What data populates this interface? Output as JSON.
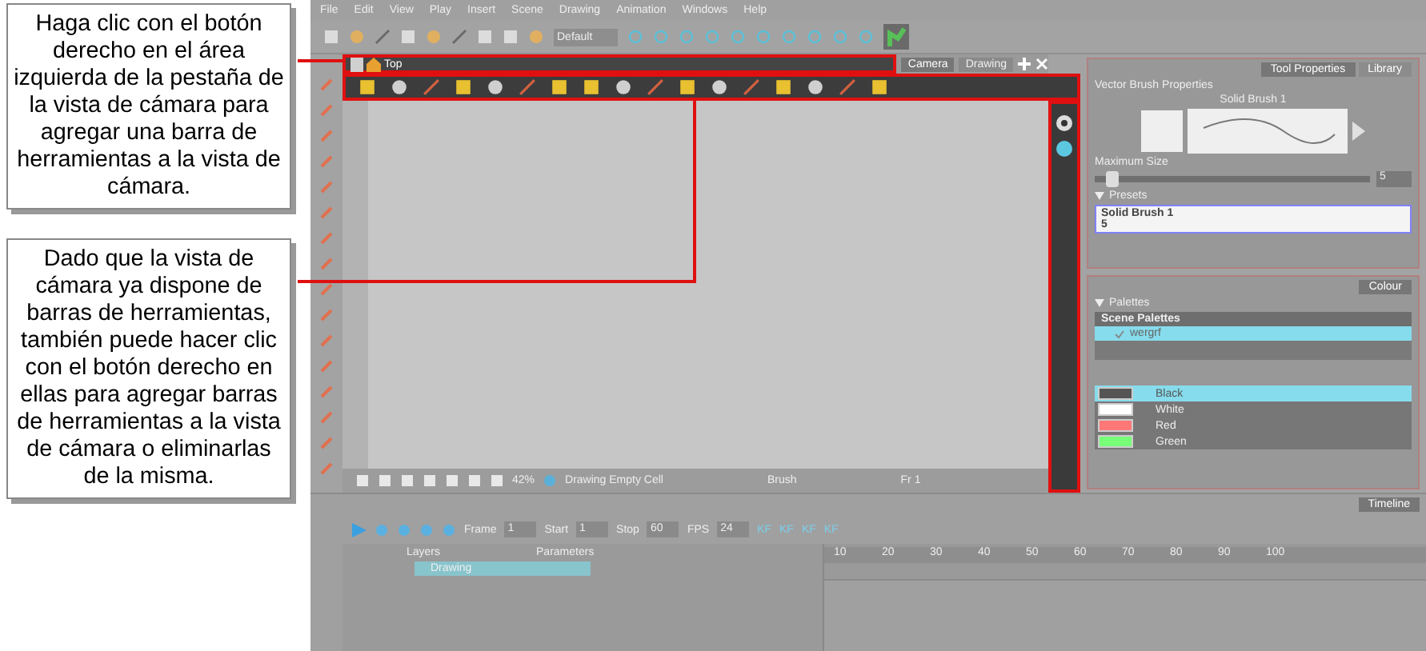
{
  "callouts": [
    "Haga clic con el botón derecho en el área izquierda de la pestaña de la vista de cámara para agregar una barra de herramientas a la vista de cámara.",
    "Dado que la vista de cámara ya dispone de barras de herramientas, también puede hacer clic con el botón derecho en ellas para agregar barras de herramientas a la vista de cámara o eliminarlas de la misma."
  ],
  "menu": [
    "File",
    "Edit",
    "View",
    "Play",
    "Insert",
    "Scene",
    "Drawing",
    "Animation",
    "Windows",
    "Help"
  ],
  "toolbar": {
    "preset": "Default"
  },
  "camera": {
    "tab_title": "Top",
    "view_tabs": [
      {
        "label": "Camera",
        "selected": true
      },
      {
        "label": "Drawing",
        "selected": false
      }
    ],
    "status": {
      "zoom": "42%",
      "cell": "Drawing Empty Cell",
      "tool": "Brush",
      "frame": "Fr 1"
    }
  },
  "tool_properties": {
    "tabs": [
      {
        "label": "Tool Properties",
        "selected": true
      },
      {
        "label": "Library",
        "selected": false
      }
    ],
    "group": "Vector Brush Properties",
    "brush_name": "Solid Brush 1",
    "size_label": "Maximum Size",
    "size_value": "5",
    "size_slider": {
      "level": 0.04
    },
    "presets_label": "Presets",
    "presets": [
      {
        "name": "Solid Brush 1",
        "size": "5",
        "selected": true
      }
    ]
  },
  "colour": {
    "tab": "Colour",
    "palettes_label": "Palettes",
    "list_title": "Scene Palettes",
    "palettes": [
      {
        "name": "wergrf",
        "selected": true
      }
    ],
    "colours": [
      {
        "name": "Black",
        "color": "#555555",
        "selected": true
      },
      {
        "name": "White",
        "color": "#ffffff",
        "selected": false
      },
      {
        "name": "Red",
        "color": "#ff7878",
        "selected": false
      },
      {
        "name": "Green",
        "color": "#78ff78",
        "selected": false
      }
    ]
  },
  "timeline": {
    "tab": "Timeline",
    "frame_label": "Frame",
    "frame": "1",
    "start_label": "Start",
    "start": "1",
    "stop_label": "Stop",
    "stop": "60",
    "fps_label": "FPS",
    "fps": "24",
    "kf": [
      "KF",
      "KF",
      "KF",
      "KF"
    ],
    "layers_label": "Layers",
    "parameters_label": "Parameters",
    "layers": [
      {
        "name": "Drawing",
        "selected": true
      }
    ],
    "ruler": [
      "10",
      "20",
      "30",
      "40",
      "50",
      "60",
      "70",
      "80",
      "90",
      "100"
    ]
  }
}
